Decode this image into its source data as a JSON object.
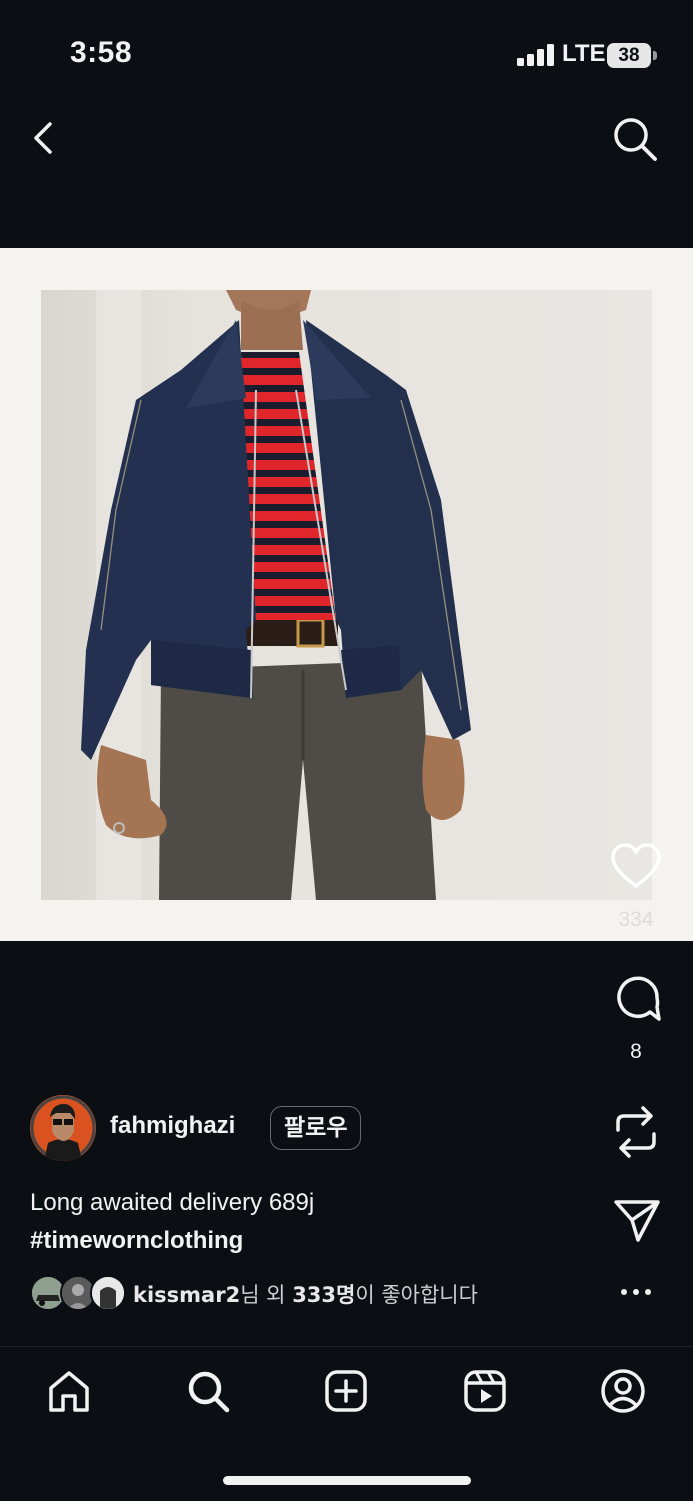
{
  "status_bar": {
    "time": "3:58",
    "network": "LTE",
    "battery": "38"
  },
  "top_bar": {
    "back_icon": "chevron-left-icon",
    "search_icon": "search-icon"
  },
  "post": {
    "image_alt": "Man wearing dark indigo denim zip jacket over red and navy striped shirt, brown belt and grey trousers",
    "likes_count": "334",
    "comments_count": "8",
    "author": {
      "username": "fahmighazi",
      "follow_label": "팔로우"
    },
    "caption_line1": "Long awaited delivery 689j",
    "caption_hashtag": "#timewornclothing",
    "liked_by": {
      "name": "kissmar2",
      "suffix_1": "님 외 ",
      "count": "333명",
      "suffix_2": "이 좋아합니다"
    }
  },
  "tab_bar": {
    "tabs": [
      "home-icon",
      "search-icon",
      "add-post-icon",
      "reels-icon",
      "profile-icon"
    ]
  },
  "colors": {
    "background": "#0b0f14",
    "text": "#f2f2f2",
    "image_bg": "#f5f3ef"
  }
}
